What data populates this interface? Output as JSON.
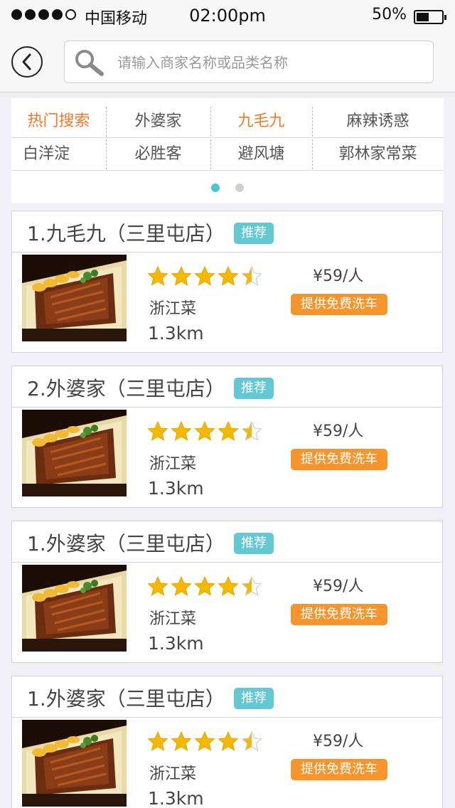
{
  "status_bar": {
    "carrier": "中国移动",
    "time": "02:00pm",
    "battery_text": "50%",
    "battery_level": 0.5,
    "signal_filled": 4,
    "signal_total": 5
  },
  "header": {
    "back_icon": "chevron-left-icon",
    "search_icon": "search-icon",
    "search_placeholder": "请输入商家名称或品类名称",
    "search_value": ""
  },
  "hot_search": {
    "title": "热门搜索",
    "items_row1": [
      "外婆家",
      "九毛九",
      "麻辣诱惑"
    ],
    "items_row2": [
      "白洋淀",
      "必胜客",
      "避风塘",
      "郭林家常菜"
    ],
    "highlight_color": "#f07a2a",
    "page_count": 2,
    "active_page": 1
  },
  "colors": {
    "accent_teal": "#62c8d4",
    "promo_orange": "#f7952c",
    "star_gold": "#f5b800"
  },
  "restaurants": [
    {
      "name": "1.九毛九（三里屯店）",
      "badge": "推荐",
      "rating": 4.5,
      "cuisine": "浙江菜",
      "distance": "1.3km",
      "price": "¥59/人",
      "promo": "提供免费洗车"
    },
    {
      "name": "2.外婆家（三里屯店）",
      "badge": "推荐",
      "rating": 4.5,
      "cuisine": "浙江菜",
      "distance": "1.3km",
      "price": "¥59/人",
      "promo": "提供免费洗车"
    },
    {
      "name": "1.外婆家（三里屯店）",
      "badge": "推荐",
      "rating": 4.5,
      "cuisine": "浙江菜",
      "distance": "1.3km",
      "price": "¥59/人",
      "promo": "提供免费洗车"
    },
    {
      "name": "1.外婆家（三里屯店）",
      "badge": "推荐",
      "rating": 4.5,
      "cuisine": "浙江菜",
      "distance": "1.3km",
      "price": "¥59/人",
      "promo": "提供免费洗车"
    }
  ]
}
